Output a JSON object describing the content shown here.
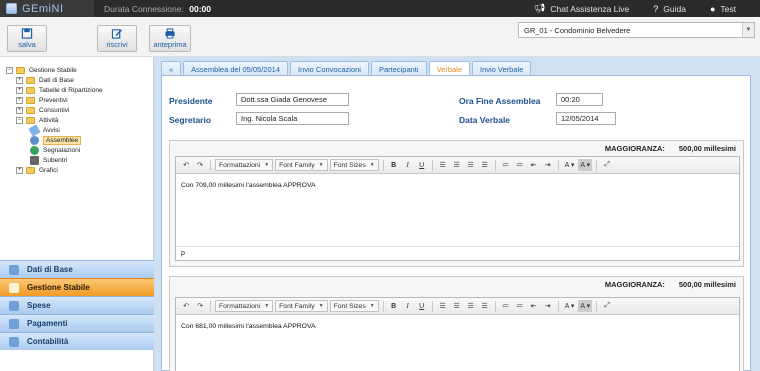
{
  "topbar": {
    "app_name": "GEmiNI",
    "connection_label": "Durata Connessione:",
    "connection_time": "00:00",
    "chat_label": "Chat Assistenza Live",
    "help_label": "Guida",
    "user_label": "Test"
  },
  "toolbar": {
    "save_label": "salva",
    "rewrite_label": "riscrivi",
    "preview_label": "anteprima",
    "condominium_selected": "GR_01 - Condominio Belvedere"
  },
  "tree": {
    "root": "Gestione Stabile",
    "items": [
      "Dati di Base",
      "Tabelle di Ripartizione",
      "Preventivi",
      "Consuntivi",
      "Attività"
    ],
    "activity_children": [
      "Avvisi",
      "Assemblee",
      "Segnalazioni",
      "Subentri"
    ],
    "last": "Grafici"
  },
  "accordion": [
    "Dati di Base",
    "Gestione Stabile",
    "Spese",
    "Pagamenti",
    "Contabilità"
  ],
  "tabs": [
    "«",
    "Assemblea del 05/05/2014",
    "Invio Convocazioni",
    "Partecipanti",
    "Verbale",
    "Invio Verbale"
  ],
  "form": {
    "president_label": "Presidente",
    "president_value": "Dott.ssa Giada Genovese",
    "secretary_label": "Segretario",
    "secretary_value": "Ing. Nicola Scala",
    "end_time_label": "Ora Fine Assemblea",
    "end_time_value": "00:20",
    "date_label": "Data Verbale",
    "date_value": "12/05/2014"
  },
  "editor": {
    "majority_label": "MAGGIORANZA:",
    "formats_label": "Formattazioni",
    "font_family_label": "Font Family",
    "font_sizes_label": "Font Sizes",
    "path_label": "p"
  },
  "sections": [
    {
      "majority_value": "500,00 millesimi",
      "text": "Con 709,00 millesimi l'assemblea APPROVA"
    },
    {
      "majority_value": "500,00 millesimi",
      "text": "Con 681,00 millesimi l'assemblea APPROVA"
    }
  ],
  "colors": {
    "accent": "#e88a1a",
    "label_blue": "#1c4f8f",
    "link_blue": "#1d5fa8"
  }
}
